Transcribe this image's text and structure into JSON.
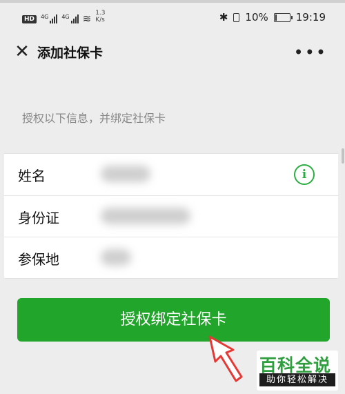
{
  "status_bar": {
    "hd": "HD",
    "net_1": "4G",
    "net_2": "4G",
    "speed_value": "1.3",
    "speed_unit": "K/s",
    "battery": "10%",
    "time": "19:19"
  },
  "nav": {
    "title": "添加社保卡",
    "close_icon": "close-icon",
    "more_icon": "more-icon"
  },
  "hint": "授权以下信息，并绑定社保卡",
  "info_rows": [
    {
      "label": "姓名"
    },
    {
      "label": "身份证"
    },
    {
      "label": "参保地"
    }
  ],
  "submit_label": "授权绑定社保卡",
  "watermark": {
    "title": "百科全说",
    "subtitle": "助你轻松解决"
  },
  "colors": {
    "accent": "#21a52a",
    "background": "#ededed"
  }
}
